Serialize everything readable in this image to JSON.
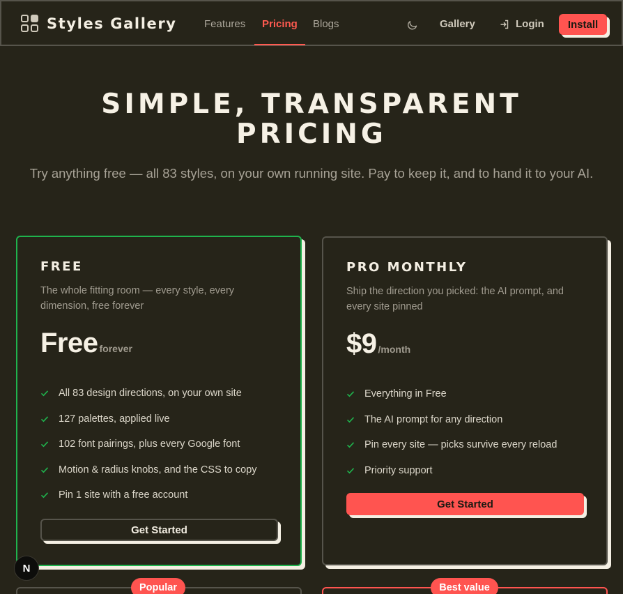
{
  "nav": {
    "brand": "Styles Gallery",
    "links": [
      {
        "label": "Features"
      },
      {
        "label": "Pricing",
        "active": true
      },
      {
        "label": "Blogs"
      }
    ],
    "gallery": "Gallery",
    "login": "Login",
    "install": "Install",
    "theme_icon": "moon-icon"
  },
  "hero": {
    "title": "SIMPLE, TRANSPARENT PRICING",
    "subtitle": "Try anything free — all 83 styles, on your own running site. Pay to keep it, and to hand it to your AI."
  },
  "plans": [
    {
      "name": "FREE",
      "description": "The whole fitting room — every style, every dimension, free forever",
      "price": "Free",
      "unit": "forever",
      "features": [
        "All 83 design directions, on your own site",
        "127 palettes, applied live",
        "102 font pairings, plus every Google font",
        "Motion & radius knobs, and the CSS to copy",
        "Pin 1 site with a free account"
      ],
      "cta": "Get Started"
    },
    {
      "name": "PRO MONTHLY",
      "description": "Ship the direction you picked: the AI prompt, and every site pinned",
      "price": "$9",
      "unit": "/month",
      "features": [
        "Everything in Free",
        "The AI prompt for any direction",
        "Pin every site — picks survive every reload",
        "Priority support"
      ],
      "cta": "Get Started"
    }
  ],
  "badges": {
    "popular": "Popular",
    "best_value": "Best value"
  },
  "dev_badge": "N",
  "colors": {
    "background": "#262419",
    "accent": "#ff5450",
    "highlight_border": "#1fb34d",
    "check": "#1fb34d"
  }
}
